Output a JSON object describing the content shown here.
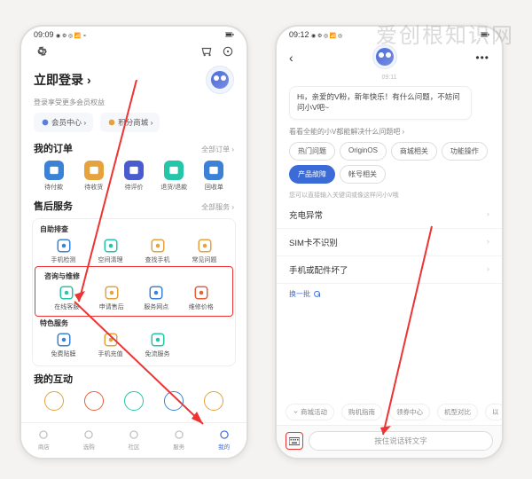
{
  "watermark": "爱创根知识网",
  "left": {
    "status": {
      "time": "09:09"
    },
    "login": {
      "title": "立即登录",
      "subtitle": "登录享受更多会员权益"
    },
    "pills": [
      {
        "icon": "badge-icon",
        "label": "会员中心 ›",
        "color": "#5a7de0"
      },
      {
        "icon": "coin-icon",
        "label": "积分商城 ›",
        "color": "#e6a23c"
      }
    ],
    "orders": {
      "title": "我的订单",
      "link": "全部订单 ›",
      "items": [
        {
          "label": "待付款",
          "color": "#3b82d6"
        },
        {
          "label": "待收货",
          "color": "#e6a23c"
        },
        {
          "label": "待评价",
          "color": "#4a5bd0"
        },
        {
          "label": "退货/退款",
          "color": "#23c6a8"
        },
        {
          "label": "回收单",
          "color": "#3b82d6"
        }
      ]
    },
    "service": {
      "title": "售后服务",
      "link": "全部服务 ›",
      "groups": [
        {
          "sub": "自助排查",
          "items": [
            {
              "label": "手机检测",
              "color": "#3b82d6"
            },
            {
              "label": "空间清理",
              "color": "#23c6a8"
            },
            {
              "label": "查找手机",
              "color": "#e6a23c"
            },
            {
              "label": "常见问题",
              "color": "#e6a23c"
            }
          ]
        },
        {
          "sub": "咨询与维修",
          "highlight": true,
          "items": [
            {
              "label": "在线客服",
              "color": "#23c6a8"
            },
            {
              "label": "申请售后",
              "color": "#e6a23c"
            },
            {
              "label": "服务网点",
              "color": "#3b82d6"
            },
            {
              "label": "维修价格",
              "color": "#e6603c"
            }
          ]
        },
        {
          "sub": "特色服务",
          "items": [
            {
              "label": "免费贴膜",
              "color": "#3b82d6"
            },
            {
              "label": "手机充值",
              "color": "#e6a23c"
            },
            {
              "label": "免流服务",
              "color": "#23c6a8"
            }
          ]
        }
      ]
    },
    "interact": {
      "title": "我的互动",
      "colors": [
        "#e6a23c",
        "#e6603c",
        "#23c6a8",
        "#3b82d6",
        "#e6a23c"
      ]
    },
    "nav": [
      {
        "label": "商店"
      },
      {
        "label": "选购"
      },
      {
        "label": "社区"
      },
      {
        "label": "服务"
      },
      {
        "label": "我的",
        "active": true
      }
    ]
  },
  "right": {
    "status": {
      "time": "09:12"
    },
    "chat_time": "09:11",
    "greeting": "Hi，亲爱的V粉，新年快乐！有什么问题，不妨问问小V吧~",
    "hint": "看看全能的小V都能解决什么问题吧 ›",
    "chips": [
      {
        "label": "热门问题"
      },
      {
        "label": "OriginOS"
      },
      {
        "label": "商城相关"
      },
      {
        "label": "功能操作"
      },
      {
        "label": "产品故障",
        "active": true
      },
      {
        "label": "帐号相关"
      }
    ],
    "direct_hint": "您可以直接输入关键词或像这样问小V哦",
    "quick": [
      "充电异常",
      "SIM卡不识别",
      "手机或配件坏了"
    ],
    "swap": "换一批",
    "bottom_chips": [
      "商城活动",
      "购机指南",
      "领券中心",
      "机型对比",
      "以"
    ],
    "voice_placeholder": "按住说话转文字"
  }
}
